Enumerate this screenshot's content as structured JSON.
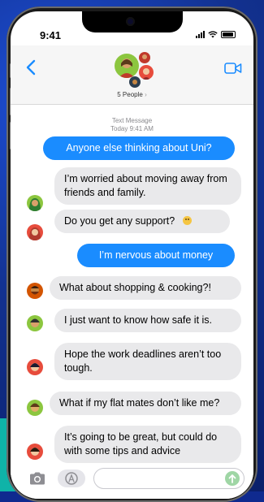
{
  "status": {
    "time": "9:41"
  },
  "header": {
    "group_name": "5 People",
    "chevron": "›"
  },
  "meta": {
    "label": "Text Message",
    "time": "Today 9:41 AM"
  },
  "messages": [
    {
      "text": "Anyone else thinking about Uni?",
      "dir": "out"
    },
    {
      "text": "I’m worried about moving away from friends and family.",
      "dir": "in",
      "avatar": "avatar-green-hijab"
    },
    {
      "text": "Do you get any support?",
      "dir": "in",
      "avatar": "avatar-red-hijab",
      "emoji": "smiling-face-icon"
    },
    {
      "text": "I’m nervous about money",
      "dir": "out"
    },
    {
      "text": "What about shopping & cooking?!",
      "dir": "in",
      "avatar": "avatar-orange-beard"
    },
    {
      "text": "I just want to know how safe it is.",
      "dir": "in",
      "avatar": "avatar-green-hair"
    },
    {
      "text": "Hope the work deadlines aren’t too tough.",
      "dir": "in",
      "avatar": "avatar-dark-hair"
    },
    {
      "text": "What if my flat mates don’t like me?",
      "dir": "in",
      "avatar": "avatar-green-hair-2"
    },
    {
      "text": "It’s going to be great, but could do with some tips and advice",
      "dir": "in",
      "avatar": "avatar-dark-hair-2"
    }
  ],
  "composer": {
    "placeholder": ""
  },
  "icons": {
    "back": "chevron-left-icon",
    "video": "video-camera-icon",
    "camera": "camera-icon",
    "apps": "app-store-icon",
    "send": "arrow-up-icon"
  },
  "colors": {
    "outgoing_bubble": "#1a8cff",
    "incoming_bubble": "#e9e9eb",
    "accent": "#1a8cff",
    "background": "#0f2a8f"
  }
}
